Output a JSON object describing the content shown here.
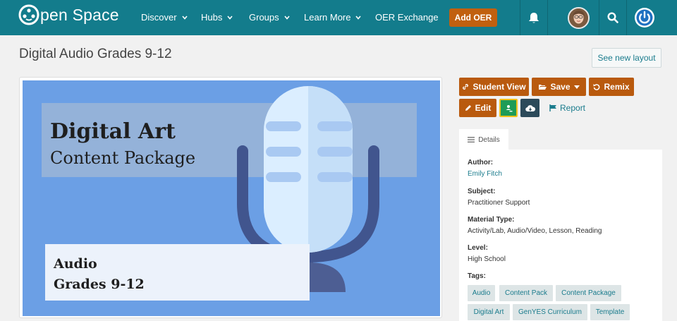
{
  "nav": {
    "logo_text": "pen Space",
    "items": [
      {
        "label": "Discover"
      },
      {
        "label": "Hubs"
      },
      {
        "label": "Groups"
      },
      {
        "label": "Learn More"
      },
      {
        "label": "OER Exchange"
      }
    ],
    "add_button": "Add OER",
    "icons": [
      "bell-icon",
      "avatar",
      "search-icon",
      "power-icon"
    ]
  },
  "page": {
    "title": "Digital Audio Grades 9-12",
    "new_layout_button": "See new layout"
  },
  "hero": {
    "line1": "Digital Art",
    "line2": "Content Package",
    "line3": "Audio",
    "line4": "Grades 9-12"
  },
  "actions": {
    "student_view": "Student View",
    "save": "Save",
    "remix": "Remix",
    "edit": "Edit",
    "report": "Report"
  },
  "details": {
    "tab_label": "Details",
    "author_label": "Author:",
    "author": "Emily Fitch",
    "subject_label": "Subject:",
    "subject": "Practitioner Support",
    "material_label": "Material Type:",
    "material": "Activity/Lab, Audio/Video, Lesson, Reading",
    "level_label": "Level:",
    "level": "High School",
    "tags_label": "Tags:",
    "tags": [
      "Audio",
      "Content Pack",
      "Content Package",
      "Digital Art",
      "GenYES Curriculum",
      "Template"
    ]
  },
  "colors": {
    "nav_bg": "#137c8c",
    "accent_orange": "#b95a0e",
    "link": "#1b7c8d",
    "classroom_green": "#1e9c57",
    "download_dark": "#2c4a5a"
  }
}
